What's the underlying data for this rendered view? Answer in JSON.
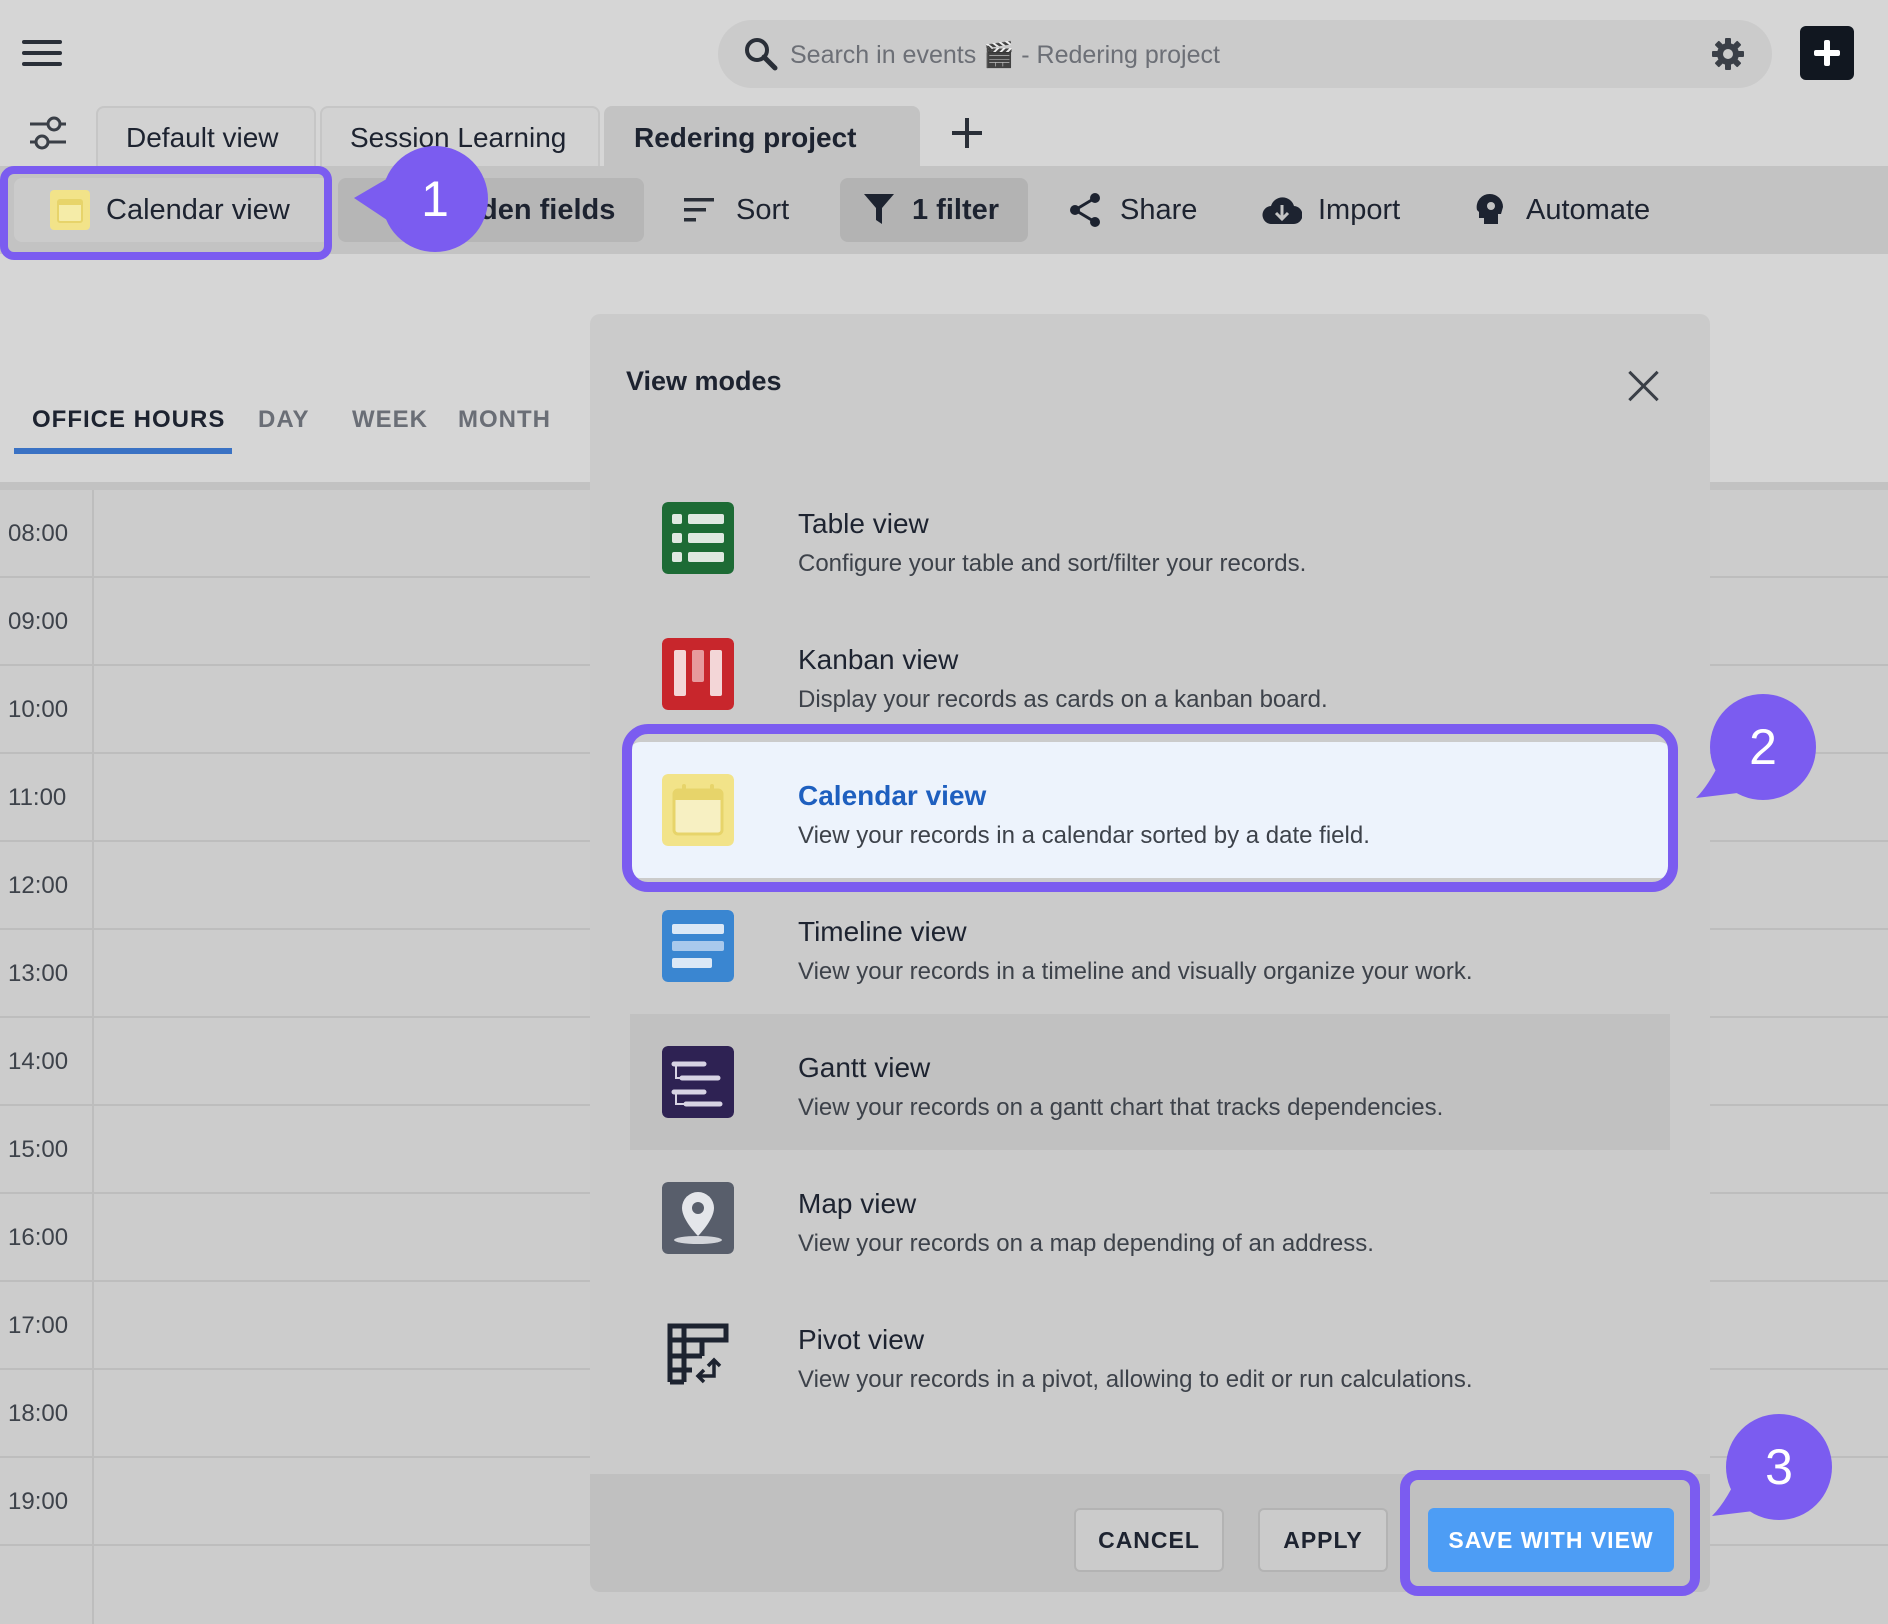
{
  "header": {
    "search_placeholder": "Search in events 🎬 - Redering project"
  },
  "tabs": [
    {
      "label": "Default view"
    },
    {
      "label": "Session Learning"
    },
    {
      "label": "Redering project"
    }
  ],
  "toolbar": {
    "calendar_view": "Calendar view",
    "hidden_fields": "den fields",
    "sort": "Sort",
    "filter": "1 filter",
    "share": "Share",
    "import": "Import",
    "automate": "Automate"
  },
  "calendar": {
    "modes": [
      "OFFICE HOURS",
      "DAY",
      "WEEK",
      "MONTH"
    ],
    "active_mode": "OFFICE HOURS",
    "hours": [
      "08:00",
      "09:00",
      "10:00",
      "11:00",
      "12:00",
      "13:00",
      "14:00",
      "15:00",
      "16:00",
      "17:00",
      "18:00",
      "19:00"
    ]
  },
  "modal": {
    "title": "View modes",
    "options": [
      {
        "name": "Table view",
        "desc": "Configure your table and sort/filter your records.",
        "icon": "table-icon",
        "color": "#1d6b35"
      },
      {
        "name": "Kanban view",
        "desc": "Display your records as cards on a kanban board.",
        "icon": "kanban-icon",
        "color": "#c8262c"
      },
      {
        "name": "Calendar view",
        "desc": "View your records in a calendar sorted by a date field.",
        "icon": "calendar-icon",
        "color": "#f2e389",
        "selected": true
      },
      {
        "name": "Timeline view",
        "desc": "View your records in a timeline and visually organize your work.",
        "icon": "timeline-icon",
        "color": "#3a86d1"
      },
      {
        "name": "Gantt view",
        "desc": "View your records on a gantt chart that tracks dependencies.",
        "icon": "gantt-icon",
        "color": "#2e2253"
      },
      {
        "name": "Map view",
        "desc": "View your records on a map depending of an address.",
        "icon": "map-pin-icon",
        "color": "#585e6b"
      },
      {
        "name": "Pivot view",
        "desc": "View your records in a pivot, allowing to edit or run calculations.",
        "icon": "pivot-icon",
        "color": "#1d2330"
      }
    ],
    "cancel": "CANCEL",
    "apply": "APPLY",
    "save": "SAVE WITH VIEW"
  },
  "callouts": [
    "1",
    "2",
    "3"
  ],
  "colors": {
    "accent_purple": "#7b5cf0",
    "primary_blue": "#4d9df5",
    "selected_text": "#1e5fbf"
  }
}
